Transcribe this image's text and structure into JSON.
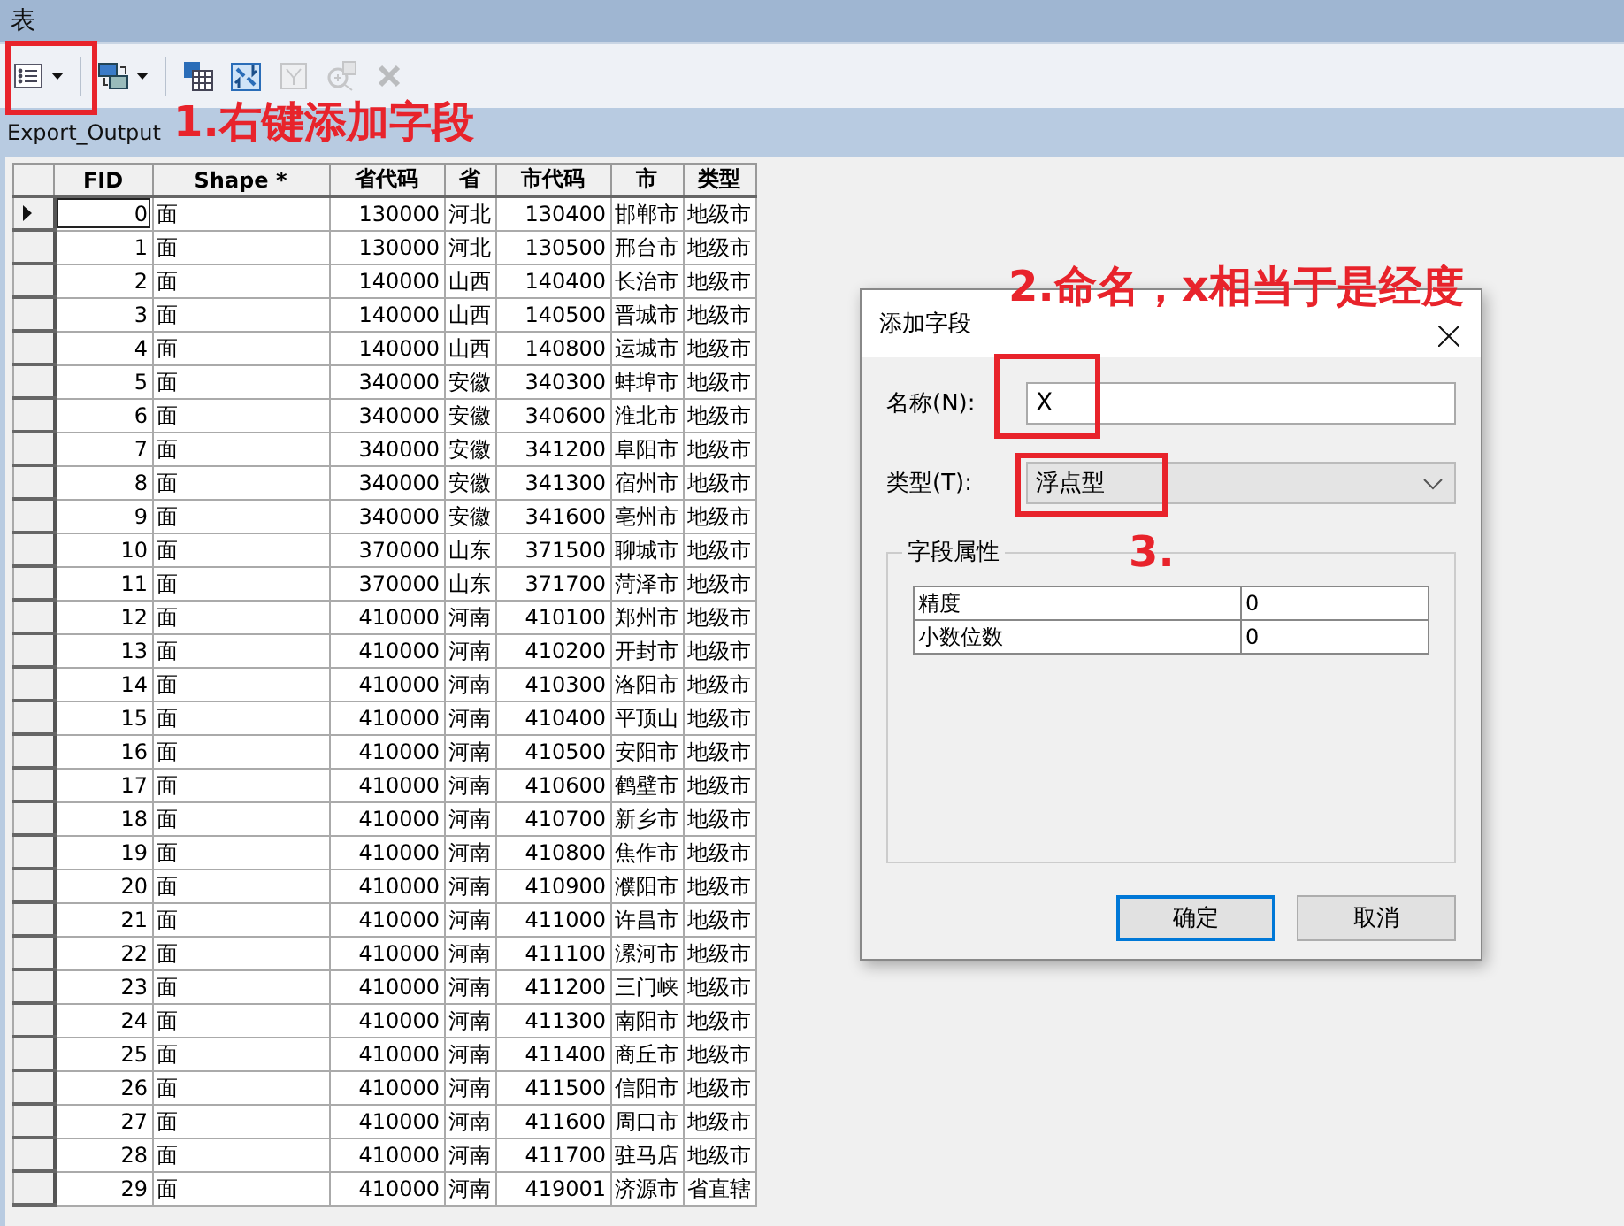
{
  "window": {
    "title": "表"
  },
  "toolbar": [
    {
      "kind": "options",
      "dropdown": true,
      "disabled": false
    },
    {
      "kind": "related",
      "dropdown": true,
      "disabled": false
    },
    {
      "kind": "select",
      "dropdown": false,
      "disabled": false
    },
    {
      "kind": "switch",
      "dropdown": false,
      "disabled": false
    },
    {
      "kind": "clear",
      "dropdown": false,
      "disabled": true
    },
    {
      "kind": "zoom",
      "dropdown": false,
      "disabled": true
    },
    {
      "kind": "delete",
      "dropdown": false,
      "disabled": true
    }
  ],
  "table": {
    "name": "Export_Output",
    "columns": [
      {
        "label": "FID",
        "kind": "number"
      },
      {
        "label": "Shape *",
        "kind": "text"
      },
      {
        "label": "省代码",
        "kind": "number"
      },
      {
        "label": "省",
        "kind": "text"
      },
      {
        "label": "市代码",
        "kind": "number"
      },
      {
        "label": "市",
        "kind": "text"
      },
      {
        "label": "类型",
        "kind": "text"
      }
    ],
    "rows": [
      {
        "selected": true,
        "cells": [
          "0",
          "面",
          "130000",
          "河北",
          "130400",
          "邯郸市",
          "地级市"
        ]
      },
      {
        "selected": false,
        "cells": [
          "1",
          "面",
          "130000",
          "河北",
          "130500",
          "邢台市",
          "地级市"
        ]
      },
      {
        "selected": false,
        "cells": [
          "2",
          "面",
          "140000",
          "山西",
          "140400",
          "长治市",
          "地级市"
        ]
      },
      {
        "selected": false,
        "cells": [
          "3",
          "面",
          "140000",
          "山西",
          "140500",
          "晋城市",
          "地级市"
        ]
      },
      {
        "selected": false,
        "cells": [
          "4",
          "面",
          "140000",
          "山西",
          "140800",
          "运城市",
          "地级市"
        ]
      },
      {
        "selected": false,
        "cells": [
          "5",
          "面",
          "340000",
          "安徽",
          "340300",
          "蚌埠市",
          "地级市"
        ]
      },
      {
        "selected": false,
        "cells": [
          "6",
          "面",
          "340000",
          "安徽",
          "340600",
          "淮北市",
          "地级市"
        ]
      },
      {
        "selected": false,
        "cells": [
          "7",
          "面",
          "340000",
          "安徽",
          "341200",
          "阜阳市",
          "地级市"
        ]
      },
      {
        "selected": false,
        "cells": [
          "8",
          "面",
          "340000",
          "安徽",
          "341300",
          "宿州市",
          "地级市"
        ]
      },
      {
        "selected": false,
        "cells": [
          "9",
          "面",
          "340000",
          "安徽",
          "341600",
          "亳州市",
          "地级市"
        ]
      },
      {
        "selected": false,
        "cells": [
          "10",
          "面",
          "370000",
          "山东",
          "371500",
          "聊城市",
          "地级市"
        ]
      },
      {
        "selected": false,
        "cells": [
          "11",
          "面",
          "370000",
          "山东",
          "371700",
          "菏泽市",
          "地级市"
        ]
      },
      {
        "selected": false,
        "cells": [
          "12",
          "面",
          "410000",
          "河南",
          "410100",
          "郑州市",
          "地级市"
        ]
      },
      {
        "selected": false,
        "cells": [
          "13",
          "面",
          "410000",
          "河南",
          "410200",
          "开封市",
          "地级市"
        ]
      },
      {
        "selected": false,
        "cells": [
          "14",
          "面",
          "410000",
          "河南",
          "410300",
          "洛阳市",
          "地级市"
        ]
      },
      {
        "selected": false,
        "cells": [
          "15",
          "面",
          "410000",
          "河南",
          "410400",
          "平顶山",
          "地级市"
        ]
      },
      {
        "selected": false,
        "cells": [
          "16",
          "面",
          "410000",
          "河南",
          "410500",
          "安阳市",
          "地级市"
        ]
      },
      {
        "selected": false,
        "cells": [
          "17",
          "面",
          "410000",
          "河南",
          "410600",
          "鹤壁市",
          "地级市"
        ]
      },
      {
        "selected": false,
        "cells": [
          "18",
          "面",
          "410000",
          "河南",
          "410700",
          "新乡市",
          "地级市"
        ]
      },
      {
        "selected": false,
        "cells": [
          "19",
          "面",
          "410000",
          "河南",
          "410800",
          "焦作市",
          "地级市"
        ]
      },
      {
        "selected": false,
        "cells": [
          "20",
          "面",
          "410000",
          "河南",
          "410900",
          "濮阳市",
          "地级市"
        ]
      },
      {
        "selected": false,
        "cells": [
          "21",
          "面",
          "410000",
          "河南",
          "411000",
          "许昌市",
          "地级市"
        ]
      },
      {
        "selected": false,
        "cells": [
          "22",
          "面",
          "410000",
          "河南",
          "411100",
          "漯河市",
          "地级市"
        ]
      },
      {
        "selected": false,
        "cells": [
          "23",
          "面",
          "410000",
          "河南",
          "411200",
          "三门峡",
          "地级市"
        ]
      },
      {
        "selected": false,
        "cells": [
          "24",
          "面",
          "410000",
          "河南",
          "411300",
          "南阳市",
          "地级市"
        ]
      },
      {
        "selected": false,
        "cells": [
          "25",
          "面",
          "410000",
          "河南",
          "411400",
          "商丘市",
          "地级市"
        ]
      },
      {
        "selected": false,
        "cells": [
          "26",
          "面",
          "410000",
          "河南",
          "411500",
          "信阳市",
          "地级市"
        ]
      },
      {
        "selected": false,
        "cells": [
          "27",
          "面",
          "410000",
          "河南",
          "411600",
          "周口市",
          "地级市"
        ]
      },
      {
        "selected": false,
        "cells": [
          "28",
          "面",
          "410000",
          "河南",
          "411700",
          "驻马店",
          "地级市"
        ]
      },
      {
        "selected": false,
        "cells": [
          "29",
          "面",
          "410000",
          "河南",
          "419001",
          "济源市",
          "省直辖"
        ]
      }
    ]
  },
  "dialog": {
    "title": "添加字段",
    "name_label": "名称(N):",
    "name_value": "X",
    "type_label": "类型(T):",
    "type_value": "浮点型",
    "group_title": "字段属性",
    "properties": [
      {
        "name": "精度",
        "value": "0"
      },
      {
        "name": "小数位数",
        "value": "0"
      }
    ],
    "buttons": [
      {
        "label": "确定",
        "default": true
      },
      {
        "label": "取消",
        "default": false
      }
    ]
  },
  "annotations": [
    {
      "text": "1.右键添加字段"
    },
    {
      "text": "2.命名，x相当于是经度"
    },
    {
      "text": "3."
    }
  ]
}
